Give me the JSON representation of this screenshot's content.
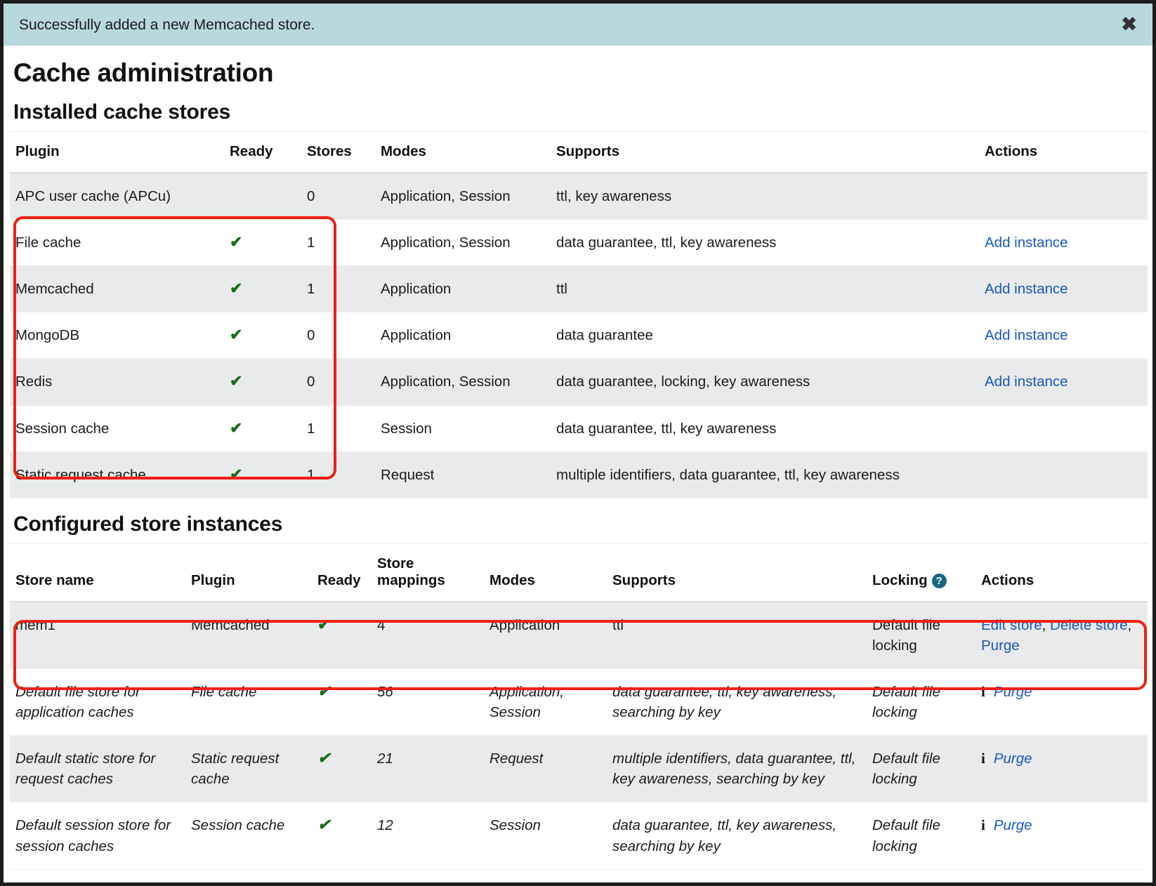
{
  "alert": {
    "message": "Successfully added a new Memcached store.",
    "close_icon": "close-icon",
    "close_label": "✖",
    "background_color": "#b8d8dd"
  },
  "page": {
    "title": "Cache administration"
  },
  "installed": {
    "section_title": "Installed cache stores",
    "columns": [
      "Plugin",
      "Ready",
      "Stores",
      "Modes",
      "Supports",
      "Actions"
    ],
    "rows": [
      {
        "plugin": "APC user cache (APCu)",
        "ready": "",
        "stores": "0",
        "modes": "Application, Session",
        "supports": "ttl, key awareness",
        "action": ""
      },
      {
        "plugin": "File cache",
        "ready": "✔",
        "stores": "1",
        "modes": "Application, Session",
        "supports": "data guarantee, ttl, key awareness",
        "action": "Add instance"
      },
      {
        "plugin": "Memcached",
        "ready": "✔",
        "stores": "1",
        "modes": "Application",
        "supports": "ttl",
        "action": "Add instance"
      },
      {
        "plugin": "MongoDB",
        "ready": "✔",
        "stores": "0",
        "modes": "Application",
        "supports": "data guarantee",
        "action": "Add instance"
      },
      {
        "plugin": "Redis",
        "ready": "✔",
        "stores": "0",
        "modes": "Application, Session",
        "supports": "data guarantee, locking, key awareness",
        "action": "Add instance"
      },
      {
        "plugin": "Session cache",
        "ready": "✔",
        "stores": "1",
        "modes": "Session",
        "supports": "data guarantee, ttl, key awareness",
        "action": ""
      },
      {
        "plugin": "Static request cache",
        "ready": "✔",
        "stores": "1",
        "modes": "Request",
        "supports": "multiple identifiers, data guarantee, ttl, key awareness",
        "action": ""
      }
    ]
  },
  "configured": {
    "section_title": "Configured store instances",
    "columns": {
      "store_name": "Store name",
      "plugin": "Plugin",
      "ready": "Ready",
      "store_mappings_line1": "Store",
      "store_mappings_line2": "mappings",
      "modes": "Modes",
      "supports": "Supports",
      "locking": "Locking",
      "locking_help_icon": "help-icon",
      "locking_help_glyph": "?",
      "actions": "Actions"
    },
    "rows": [
      {
        "store_name": "mem1",
        "plugin": "Memcached",
        "ready": "✔",
        "store_mappings": "4",
        "modes": "Application",
        "supports": "ttl",
        "locking": "Default file locking",
        "actions": [
          "Edit store",
          "Delete store",
          "Purge"
        ],
        "has_info_icon": false,
        "italic": false
      },
      {
        "store_name": "Default file store for application caches",
        "plugin": "File cache",
        "ready": "✔",
        "store_mappings": "56",
        "modes": "Application, Session",
        "supports": "data guarantee, ttl, key awareness, searching by key",
        "locking": "Default file locking",
        "actions": [
          "Purge"
        ],
        "has_info_icon": true,
        "italic": true
      },
      {
        "store_name": "Default static store for request caches",
        "plugin": "Static request cache",
        "ready": "✔",
        "store_mappings": "21",
        "modes": "Request",
        "supports": "multiple identifiers, data guarantee, ttl, key awareness, searching by key",
        "locking": "Default file locking",
        "actions": [
          "Purge"
        ],
        "has_info_icon": true,
        "italic": true
      },
      {
        "store_name": "Default session store for session caches",
        "plugin": "Session cache",
        "ready": "✔",
        "store_mappings": "12",
        "modes": "Session",
        "supports": "data guarantee, ttl, key awareness, searching by key",
        "locking": "Default file locking",
        "actions": [
          "Purge"
        ],
        "has_info_icon": true,
        "italic": true
      }
    ]
  },
  "annotations": {
    "highlight_color": "#ef2014",
    "boxes": [
      {
        "name": "plugins-rows-highlight"
      },
      {
        "name": "mem1-row-highlight"
      }
    ]
  },
  "colors": {
    "link": "#1b56bd",
    "check": "#1a6b1a",
    "stripe": "#e9eaeb",
    "help_badge": "#18677e"
  }
}
